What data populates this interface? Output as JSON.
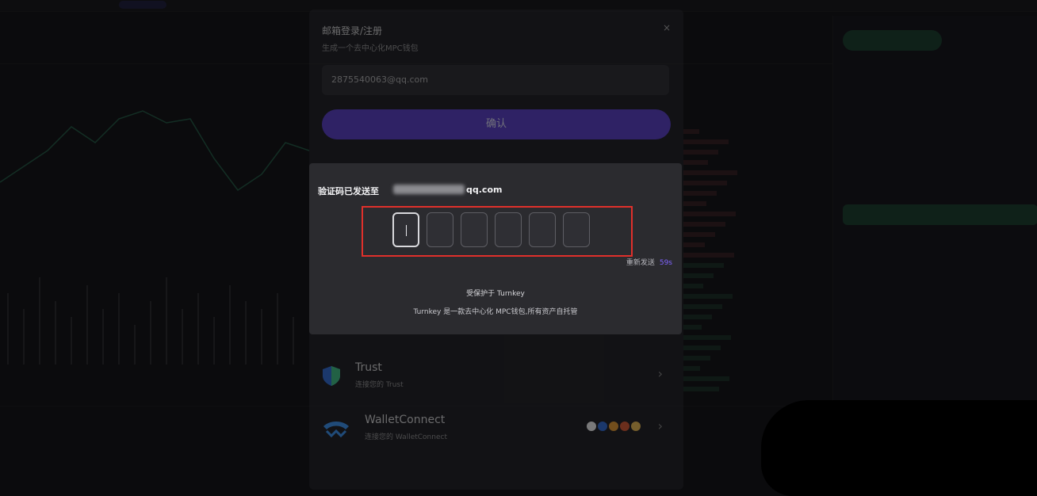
{
  "background": {
    "brand": "",
    "ticker_labels": [
      "",
      "",
      "",
      ""
    ],
    "bottom_tabs": [
      "",
      "",
      "",
      "",
      ""
    ],
    "order_book_rows": 26
  },
  "login_modal": {
    "title": "邮箱登录/注册",
    "subtitle": "生成一个去中心化MPC钱包",
    "close_glyph": "×",
    "email_value": "2875540063@qq.com",
    "confirm_label": "确认",
    "wallets": [
      {
        "name": "Trust",
        "sub": "连接您的 Trust",
        "icon": "shield-icon"
      },
      {
        "name": "WalletConnect",
        "sub": "连接您的 WalletConnect",
        "icon": "walletconnect-icon"
      }
    ],
    "chevron_glyph": "›"
  },
  "verify_dialog": {
    "sent_prefix": "验证码已发送至",
    "email_suffix": "qq.com",
    "code_boxes": 6,
    "active_box": 0,
    "resend_label": "重新发送",
    "resend_countdown": "59s",
    "protected_by": "受保护于 Turnkey",
    "protected_desc": "Turnkey 是一款去中心化 MPC钱包,所有资产自托管"
  },
  "colors": {
    "accent": "#7f63ff",
    "highlight_border": "#e0302b",
    "confirm_bg": "#5b3fd0",
    "buy_green": "#1f6e46"
  }
}
